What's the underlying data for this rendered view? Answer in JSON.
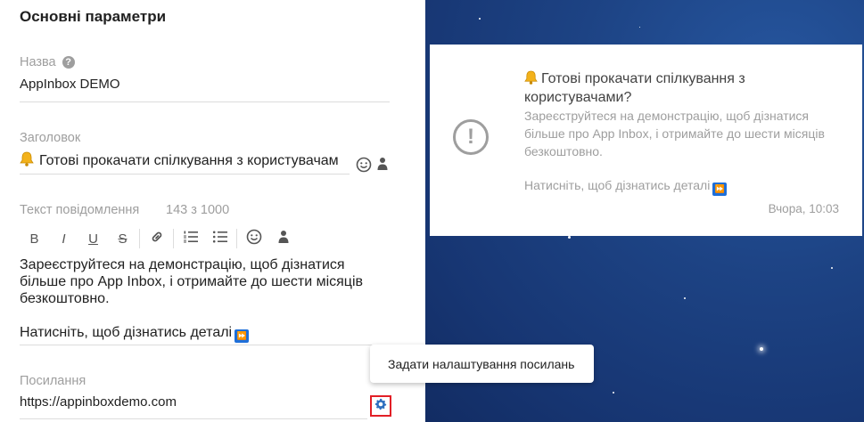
{
  "form": {
    "section_title": "Основні параметри",
    "name_label": "Назва",
    "name_value": "AppInbox DEMO",
    "title_label": "Заголовок",
    "title_value": "Готові прокачати спілкування з користувачам",
    "text_label": "Текст повідомлення",
    "text_counter": "143 з 1000",
    "toolbar": {
      "bold": "B",
      "italic": "I",
      "underline": "U",
      "strike": "S"
    },
    "body_line1": "Зареєструйтеся на демонстрацію, щоб дізнатися",
    "body_line2": "більше про App Inbox, і отримайте до шести місяців",
    "body_line3": "безкоштовно.",
    "body_line4": "Натисніть, щоб дізнатись деталі",
    "link_label": "Посилання",
    "link_value": "https://appinboxdemo.com"
  },
  "preview": {
    "title_line1": "Готові прокачати спілкування з",
    "title_line2": "користувачами?",
    "body_line1": "Зареєструйтеся на демонстрацію, щоб дізнатися",
    "body_line2": "більше про App Inbox, і отримайте до шести місяців",
    "body_line3": "безкоштовно.",
    "cta": "Натисніть, щоб дізнатись деталі",
    "time": "Вчора, 10:03"
  },
  "tooltip": {
    "text": "Задати налаштування посилань"
  },
  "icons": {
    "help": "help-circle-icon",
    "emoji": "emoji-icon",
    "person": "person-icon",
    "link": "link-icon",
    "ordered_list": "ordered-list-icon",
    "bullet_list": "bullet-list-icon",
    "gear": "gear-icon",
    "bell": "bell-emoji-icon",
    "fast_forward": "fast-forward-emoji-icon",
    "alert": "alert-circle-icon"
  },
  "colors": {
    "gear_highlight": "#e21f26",
    "preview_bg": "#1d4384"
  }
}
